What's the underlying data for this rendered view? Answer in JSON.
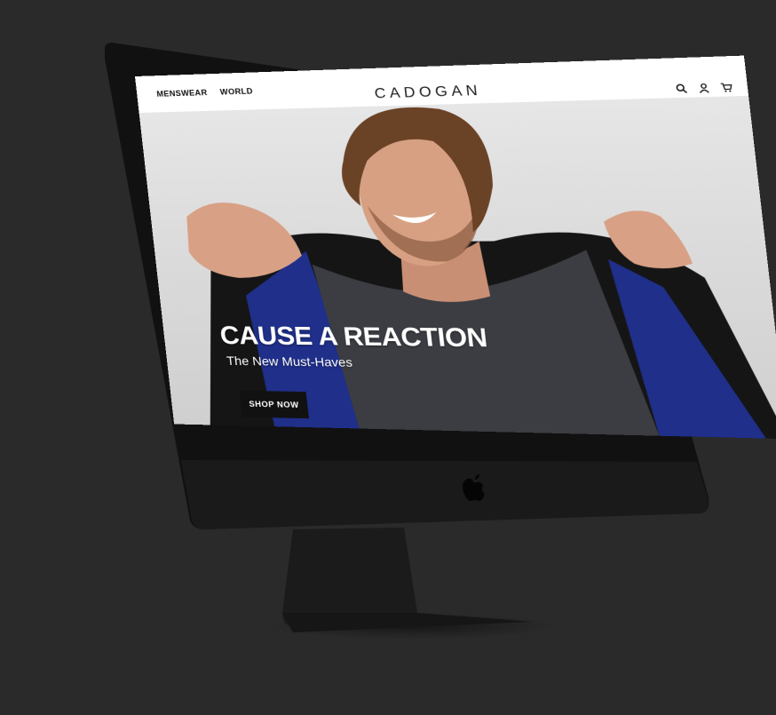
{
  "site": {
    "brand": "CADOGAN",
    "nav": [
      {
        "label": "MENSWEAR"
      },
      {
        "label": "WORLD"
      }
    ],
    "icons": [
      "search-icon",
      "account-icon",
      "cart-icon"
    ]
  },
  "hero": {
    "headline": "CAUSE A REACTION",
    "subheadline": "The New Must-Haves",
    "cta_label": "SHOP NOW"
  },
  "colors": {
    "page_background": "#2a2a2a",
    "monitor_body": "#151515",
    "header_background": "#ffffff",
    "button_background": "#111111",
    "jacket_blue": "#1f2f8a"
  },
  "device": {
    "logo": "apple-logo-icon"
  }
}
